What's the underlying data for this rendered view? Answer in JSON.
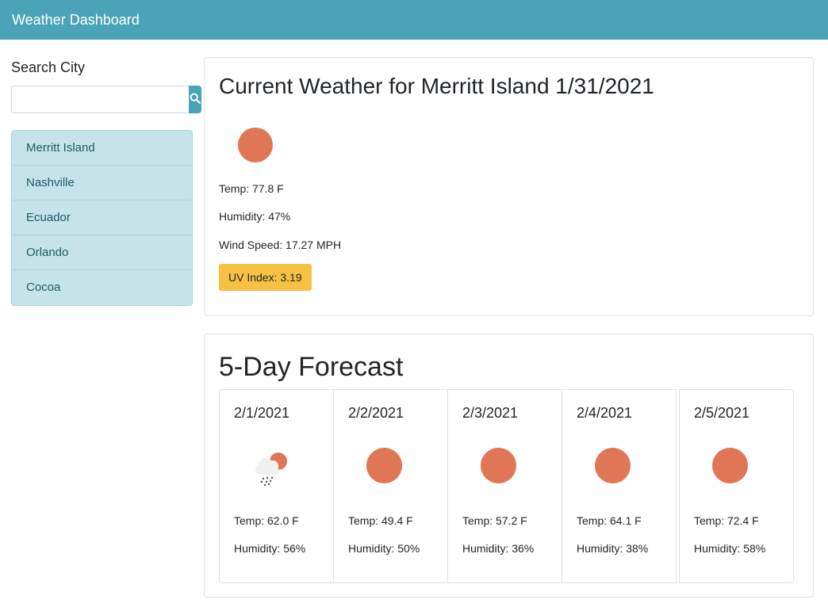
{
  "navbar": {
    "title": "Weather Dashboard"
  },
  "sidebar": {
    "heading": "Search City",
    "search": {
      "value": "",
      "placeholder": "",
      "button_icon": "search-icon"
    },
    "cities": [
      "Merritt Island",
      "Nashville",
      "Ecuador",
      "Orlando",
      "Cocoa"
    ]
  },
  "current": {
    "title": "Current Weather for Merritt Island 1/31/2021",
    "icon": "clear-sun-icon",
    "temp": "Temp: 77.8 F",
    "humidity": "Humidity: 47%",
    "wind": "Wind Speed: 17.27 MPH",
    "uv": "UV Index: 3.19",
    "uv_color": "#f7c244"
  },
  "forecast": {
    "title": "5-Day Forecast",
    "days": [
      {
        "date": "2/1/2021",
        "icon": "rain-cloud-sun-icon",
        "temp": "Temp: 62.0 F",
        "humidity": "Humidity: 56%"
      },
      {
        "date": "2/2/2021",
        "icon": "clear-sun-icon",
        "temp": "Temp: 49.4 F",
        "humidity": "Humidity: 50%"
      },
      {
        "date": "2/3/2021",
        "icon": "clear-sun-icon",
        "temp": "Temp: 57.2 F",
        "humidity": "Humidity: 36%"
      },
      {
        "date": "2/4/2021",
        "icon": "clear-sun-icon",
        "temp": "Temp: 64.1 F",
        "humidity": "Humidity: 38%"
      },
      {
        "date": "2/5/2021",
        "icon": "clear-sun-icon",
        "temp": "Temp: 72.4 F",
        "humidity": "Humidity: 58%"
      }
    ]
  },
  "colors": {
    "brand": "#4aa3b6",
    "sun": "#e07656",
    "list_bg": "#c7e3ea",
    "uv_moderate": "#f7c244"
  }
}
